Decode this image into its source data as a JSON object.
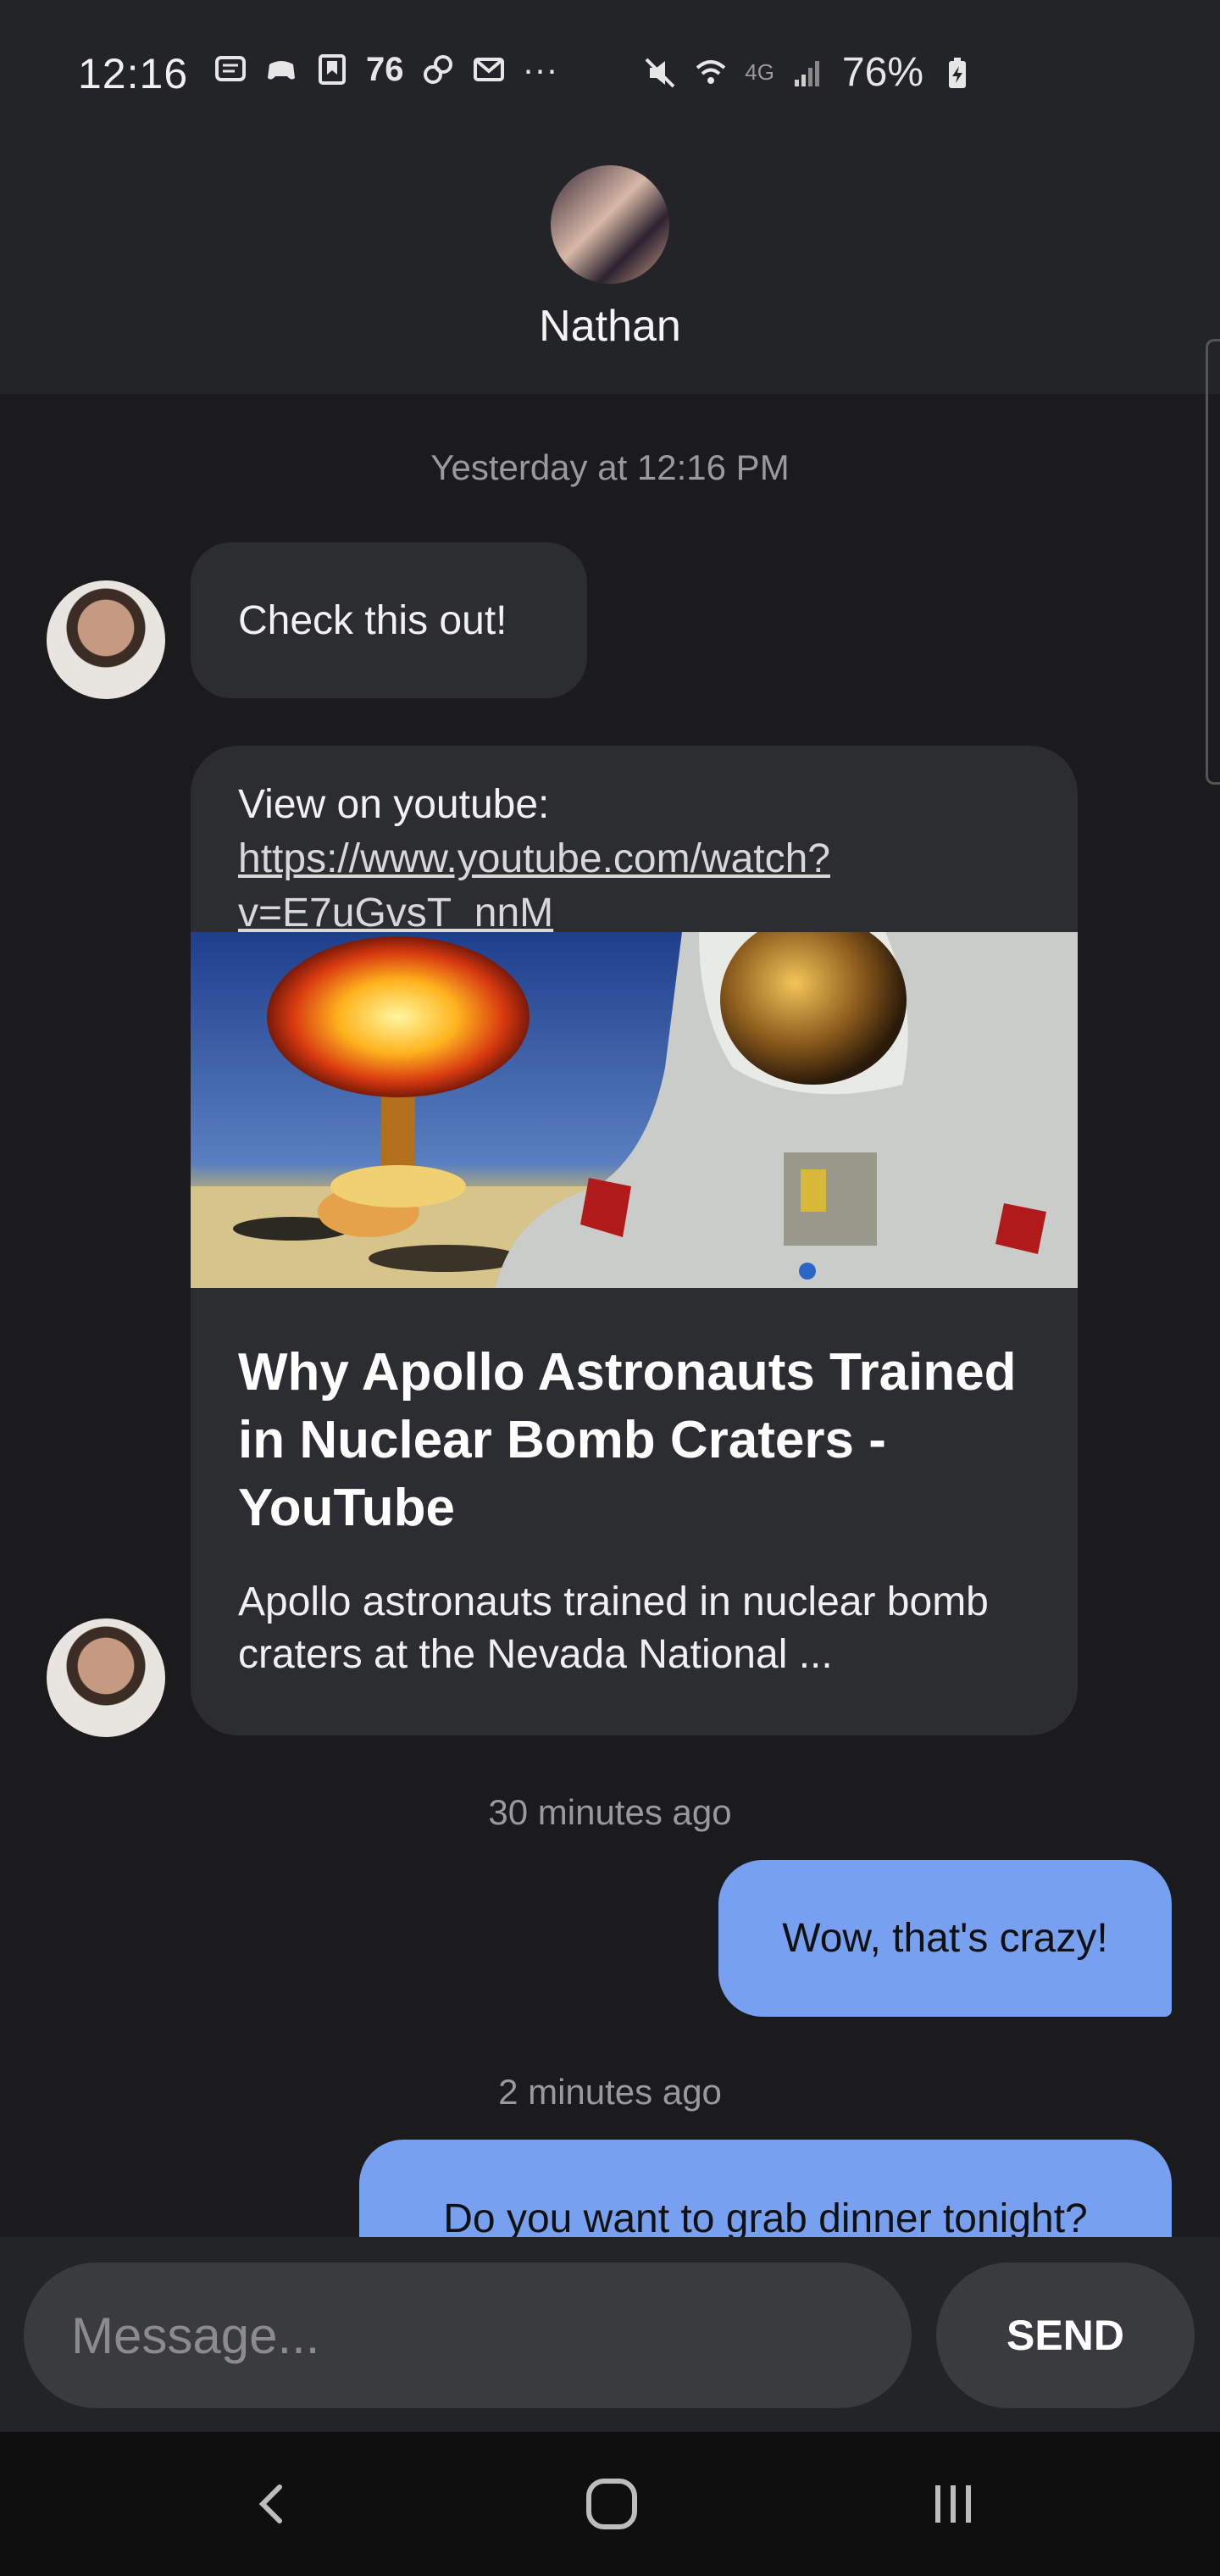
{
  "status_bar": {
    "time": "12:16",
    "notif_count": "76",
    "overflow": "···",
    "network": "4G",
    "battery": "76%"
  },
  "header": {
    "contact_name": "Nathan"
  },
  "messages": {
    "ts1": "Yesterday at 12:16 PM",
    "msg1": "Check this out!",
    "link_prefix": "View on youtube: ",
    "link_url": "https://www.youtube.com/watch?v=E7uGvsT_nnM",
    "link_title": "Why Apollo Astronauts Trained in Nuclear Bomb Craters - YouTube",
    "link_desc": "Apollo astronauts trained in nuclear bomb craters at the Nevada National ...",
    "ts2": "30 minutes ago",
    "msg2": "Wow, that's crazy!",
    "ts3": "2 minutes ago",
    "msg3": "Do you want to grab dinner tonight?"
  },
  "compose": {
    "placeholder": "Message...",
    "send_label": "SEND"
  },
  "colors": {
    "outgoing_bubble": "#78a0f0",
    "incoming_bubble": "#2c2d30",
    "background": "#1b1b1d"
  }
}
